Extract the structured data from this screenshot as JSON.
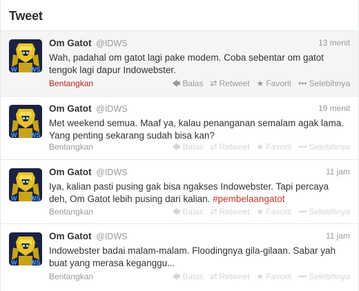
{
  "header": {
    "title": "Tweet"
  },
  "actions": {
    "reply": "Balas",
    "retweet": "Retweet",
    "favorite": "Favorit",
    "more": "Selebihnya",
    "expand": "Bentangkan"
  },
  "icons": {
    "reply": "reply-arrow-icon",
    "retweet": "retweet-icon",
    "favorite": "star-icon",
    "more": "ellipsis-icon"
  },
  "colors": {
    "hashtag": "#c0392b",
    "expand_active": "#b7261c",
    "muted": "#999999"
  },
  "tweets": [
    {
      "fullname": "Om Gatot",
      "username": "@IDWS",
      "time": "13 menit",
      "text_a": "Wah, padahal om gatot lagi pake modem. Coba sebentar om gatot tengok lagi dapur Indowebster.",
      "hashtag": "",
      "text_b": ""
    },
    {
      "fullname": "Om Gatot",
      "username": "@IDWS",
      "time": "19 menit",
      "text_a": "Met weekend semua. Maaf ya, kalau penanganan semalam agak lama. Yang penting sekarang sudah bisa kan?",
      "hashtag": "",
      "text_b": ""
    },
    {
      "fullname": "Om Gatot",
      "username": "@IDWS",
      "time": "11 jam",
      "text_a": "Iya, kalian pasti pusing gak bisa ngakses Indowebster. Tapi percaya deh, Om Gatot lebih pusing dari kalian. ",
      "hashtag": "#pembelaangatot",
      "text_b": ""
    },
    {
      "fullname": "Om Gatot",
      "username": "@IDWS",
      "time": "11 jam",
      "text_a": "Indowebster badai malam-malam. Floodingnya gila-gilaan. Sabar yah buat yang merasa keganggu...",
      "hashtag": "",
      "text_b": ""
    }
  ]
}
